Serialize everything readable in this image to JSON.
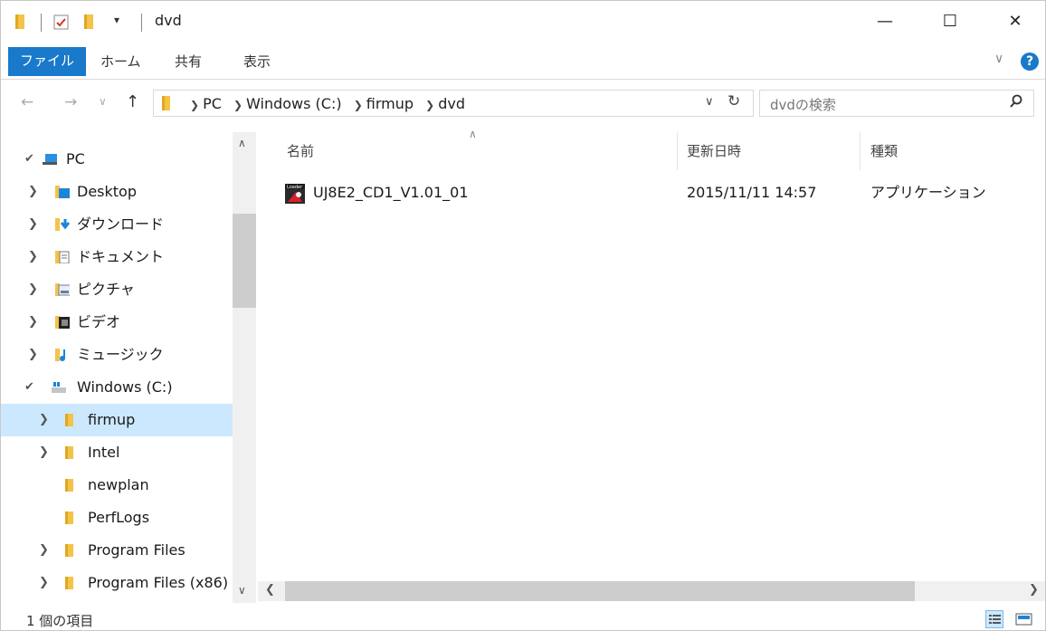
{
  "window": {
    "title": "dvd",
    "quick_access_dropdown": "▾",
    "minimize": "—",
    "maximize": "☐",
    "close": "✕"
  },
  "ribbon": {
    "tabs": [
      "ファイル",
      "ホーム",
      "共有",
      "表示"
    ],
    "help": "?"
  },
  "address": {
    "crumbs": [
      "PC",
      "Windows (C:)",
      "firmup",
      "dvd"
    ],
    "search_placeholder": "dvdの検索"
  },
  "navpane": {
    "items": [
      {
        "label": "PC",
        "icon": "pc-icon",
        "expanded": true
      },
      {
        "label": "Desktop",
        "icon": "desktop-folder-icon"
      },
      {
        "label": "ダウンロード",
        "icon": "downloads-folder-icon"
      },
      {
        "label": "ドキュメント",
        "icon": "documents-folder-icon"
      },
      {
        "label": "ピクチャ",
        "icon": "pictures-folder-icon"
      },
      {
        "label": "ビデオ",
        "icon": "videos-folder-icon"
      },
      {
        "label": "ミュージック",
        "icon": "music-folder-icon"
      },
      {
        "label": "Windows (C:)",
        "icon": "drive-icon",
        "expanded": true
      },
      {
        "label": "firmup",
        "icon": "folder-icon",
        "selected": true
      },
      {
        "label": "Intel",
        "icon": "folder-icon"
      },
      {
        "label": "newplan",
        "icon": "folder-icon"
      },
      {
        "label": "PerfLogs",
        "icon": "folder-icon"
      },
      {
        "label": "Program Files",
        "icon": "folder-icon"
      },
      {
        "label": "Program Files (x86)",
        "icon": "folder-icon"
      }
    ]
  },
  "columns": {
    "name": "名前",
    "date": "更新日時",
    "type": "種類"
  },
  "files": [
    {
      "name": "UJ8E2_CD1_V1.01_01",
      "date": "2015/11/11 14:57",
      "type": "アプリケーション",
      "icon": "application-icon"
    }
  ],
  "status": {
    "text": "1 個の項目"
  },
  "colors": {
    "accent": "#1979ca",
    "selection": "#cce8ff",
    "folder": "#f3c34a"
  }
}
